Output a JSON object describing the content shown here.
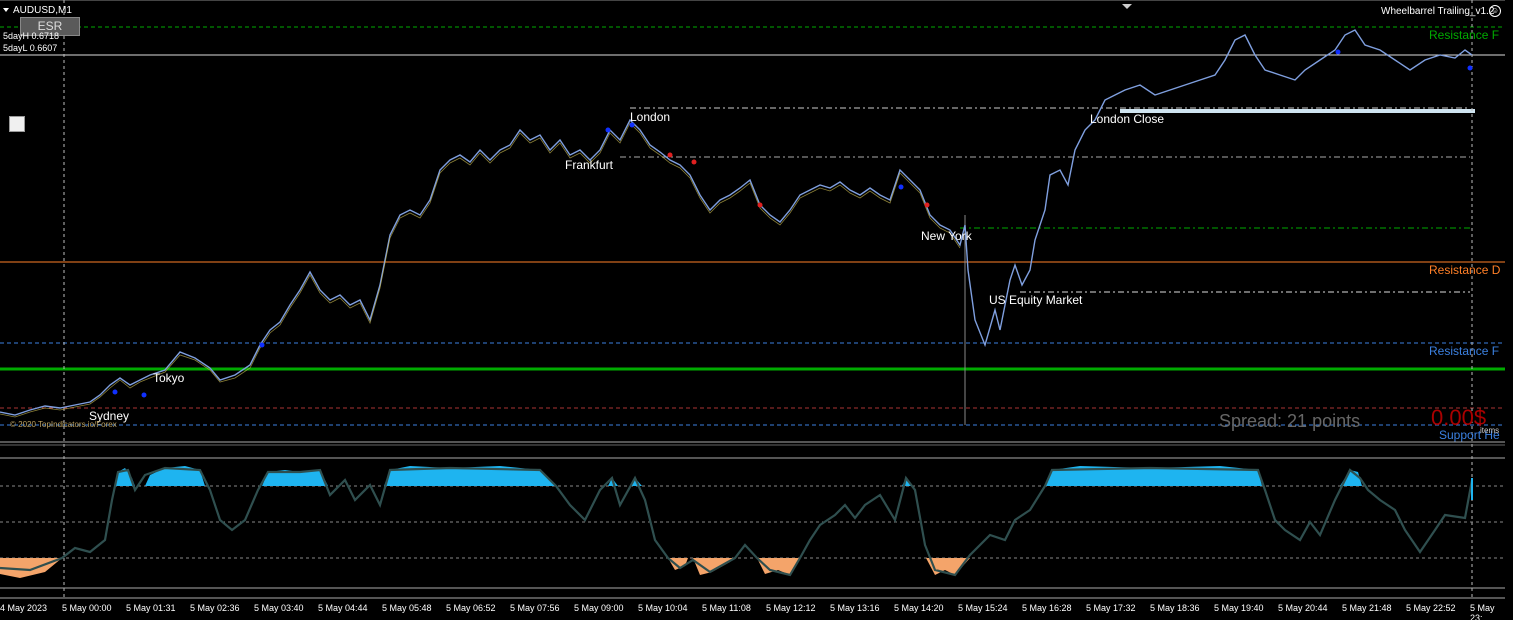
{
  "window": {
    "symbol_title": "AUDUSD,M1",
    "ea_name": "Wheelbarrel Trailing_v1.2"
  },
  "overlay": {
    "esr_button": "ESR",
    "five_day_high": "5dayH 0.6718",
    "five_day_low": "5dayL 0.6607",
    "copyright": "© 2020 TopIndicators.io/Forex"
  },
  "sessions": {
    "sydney": "Sydney",
    "tokyo": "Tokyo",
    "frankfurt": "Frankfurt",
    "london": "London",
    "new_york": "New York",
    "us_equity": "US Equity Market",
    "london_close": "London Close"
  },
  "levels": {
    "resistance_top": "Resistance F",
    "resistance_mid": "Resistance D",
    "resistance_low": "Resistance F",
    "support": "Support He",
    "spread": "Spread: 21 points",
    "profit": "0.00$",
    "items": "items"
  },
  "colors": {
    "background": "#000000",
    "price_line": "#7f9fdf",
    "resistance_green": "#00aa00",
    "resistance_orange": "#ff7f27",
    "resistance_blue": "#3b80e0",
    "oscillator_high": "#1eb4f0",
    "oscillator_low": "#f4a46a",
    "oscillator_line": "#2f4f4f"
  },
  "time_axis": [
    "4 May 2023",
    "5 May 00:00",
    "5 May 01:31",
    "5 May 02:36",
    "5 May 03:40",
    "5 May 04:44",
    "5 May 05:48",
    "5 May 06:52",
    "5 May 07:56",
    "5 May 09:00",
    "5 May 10:04",
    "5 May 11:08",
    "5 May 12:12",
    "5 May 13:16",
    "5 May 14:20",
    "5 May 15:24",
    "5 May 16:28",
    "5 May 17:32",
    "5 May 18:36",
    "5 May 19:40",
    "5 May 20:44",
    "5 May 21:48",
    "5 May 22:52",
    "5 May 23:"
  ]
}
